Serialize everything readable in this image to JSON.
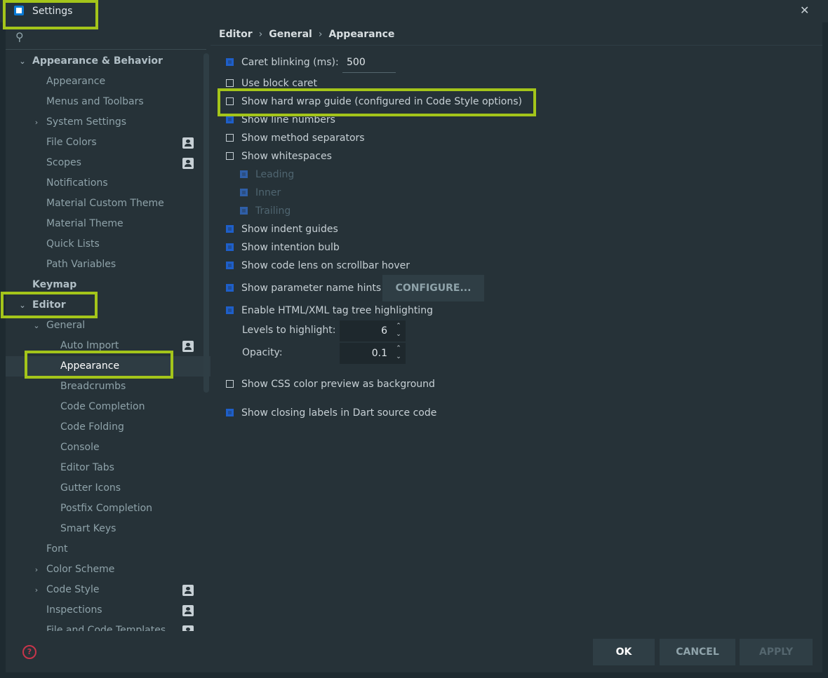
{
  "window": {
    "title": "Settings",
    "close_glyph": "✕"
  },
  "search": {
    "icon": "search-icon",
    "glyph": "⚲"
  },
  "sidebar": {
    "items": [
      {
        "label": "Appearance & Behavior",
        "arrow": "⌄"
      },
      {
        "label": "Appearance"
      },
      {
        "label": "Menus and Toolbars"
      },
      {
        "label": "System Settings",
        "arrow": "›"
      },
      {
        "label": "File Colors"
      },
      {
        "label": "Scopes"
      },
      {
        "label": "Notifications"
      },
      {
        "label": "Material Custom Theme"
      },
      {
        "label": "Material Theme"
      },
      {
        "label": "Quick Lists"
      },
      {
        "label": "Path Variables"
      },
      {
        "label": "Keymap"
      },
      {
        "label": "Editor",
        "arrow": "⌄"
      },
      {
        "label": "General",
        "arrow": "⌄"
      },
      {
        "label": "Auto Import"
      },
      {
        "label": "Appearance"
      },
      {
        "label": "Breadcrumbs"
      },
      {
        "label": "Code Completion"
      },
      {
        "label": "Code Folding"
      },
      {
        "label": "Console"
      },
      {
        "label": "Editor Tabs"
      },
      {
        "label": "Gutter Icons"
      },
      {
        "label": "Postfix Completion"
      },
      {
        "label": "Smart Keys"
      },
      {
        "label": "Font"
      },
      {
        "label": "Color Scheme",
        "arrow": "›"
      },
      {
        "label": "Code Style",
        "arrow": "›"
      },
      {
        "label": "Inspections"
      },
      {
        "label": "File and Code Templates"
      }
    ]
  },
  "breadcrumb": {
    "part1": "Editor",
    "part2": "General",
    "part3": "Appearance",
    "sep": "›"
  },
  "options": {
    "caret_blinking": {
      "label": "Caret blinking (ms):",
      "checked": true,
      "value": "500"
    },
    "block_caret": {
      "label": "Use block caret",
      "checked": false
    },
    "hard_wrap": {
      "label": "Show hard wrap guide (configured in Code Style options)",
      "checked": false
    },
    "line_numbers": {
      "label": "Show line numbers",
      "checked": true
    },
    "method_separators": {
      "label": "Show method separators",
      "checked": false
    },
    "whitespaces": {
      "label": "Show whitespaces",
      "checked": false
    },
    "leading": {
      "label": "Leading",
      "checked": true
    },
    "inner": {
      "label": "Inner",
      "checked": true
    },
    "trailing": {
      "label": "Trailing",
      "checked": true
    },
    "indent_guides": {
      "label": "Show indent guides",
      "checked": true
    },
    "intention_bulb": {
      "label": "Show intention bulb",
      "checked": true
    },
    "code_lens": {
      "label": "Show code lens on scrollbar hover",
      "checked": true
    },
    "param_hints": {
      "label": "Show parameter name hints",
      "checked": true,
      "button": "CONFIGURE..."
    },
    "tag_tree": {
      "label": "Enable HTML/XML tag tree highlighting",
      "checked": true
    },
    "levels": {
      "label": "Levels to highlight:",
      "value": "6"
    },
    "opacity": {
      "label": "Opacity:",
      "value": "0.1"
    },
    "css_preview": {
      "label": "Show CSS color preview as background",
      "checked": false
    },
    "dart_labels": {
      "label": "Show closing labels in Dart source code",
      "checked": true
    }
  },
  "spin_up": "⌃",
  "spin_down": "⌄",
  "buttons": {
    "ok": "OK",
    "cancel": "CANCEL",
    "apply": "APPLY",
    "help": "?"
  },
  "colors": {
    "background": "#263238",
    "checkbox_accent": "#1E5FC9",
    "highlight_box": "#A4C51A",
    "help_icon": "#C7354A"
  }
}
